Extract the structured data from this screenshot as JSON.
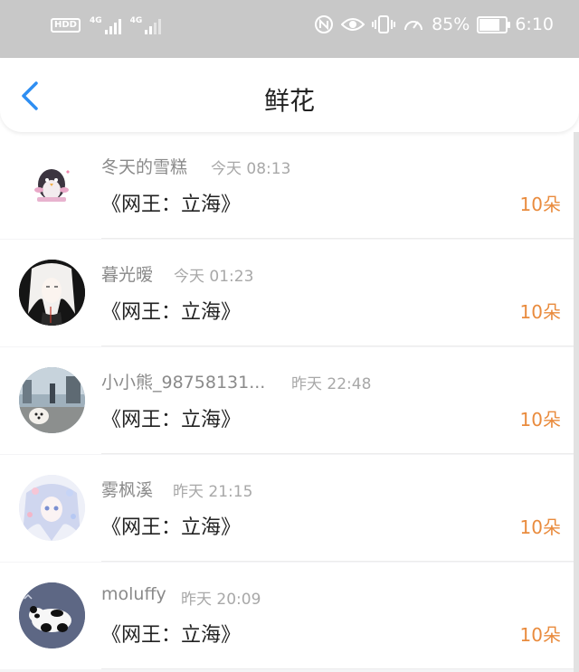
{
  "status_bar": {
    "hd_label": "HD",
    "hd_sub": "D",
    "signal1_label": "4G",
    "signal2_label": "4G",
    "battery_percent_text": "85%",
    "battery_level": 0.85,
    "time": "6:10",
    "icons": [
      "hd-voice-icon",
      "signal-icon",
      "signal-icon",
      "nfc-icon",
      "eye-icon",
      "vibrate-icon",
      "speed-icon",
      "battery-icon"
    ]
  },
  "nav": {
    "title": "鲜花",
    "back_icon": "chevron-left-icon",
    "accent_color": "#2e8ef2"
  },
  "colors": {
    "count": "#e98b3d",
    "name": "#8a8a8a",
    "time": "#a8a8a8"
  },
  "rows": [
    {
      "name": "冬天的雪糕",
      "time": "今天 08:13",
      "book": "《网王：立海》",
      "count": "10朵",
      "avatar": "penguin-avatar"
    },
    {
      "name": "暮光暧",
      "time": "今天 01:23",
      "book": "《网王：立海》",
      "count": "10朵",
      "avatar": "anime-boy-avatar"
    },
    {
      "name": "小小熊_98758131...",
      "time": "昨天 22:48",
      "book": "《网王：立海》",
      "count": "10朵",
      "avatar": "dog-photo-avatar"
    },
    {
      "name": "雾枫溪",
      "time": "昨天 21:15",
      "book": "《网王：立海》",
      "count": "10朵",
      "avatar": "anime-girl-avatar"
    },
    {
      "name": "moluffy",
      "time": "昨天 20:09",
      "book": "《网王：立海》",
      "count": "10朵",
      "avatar": "panda-avatar"
    }
  ]
}
